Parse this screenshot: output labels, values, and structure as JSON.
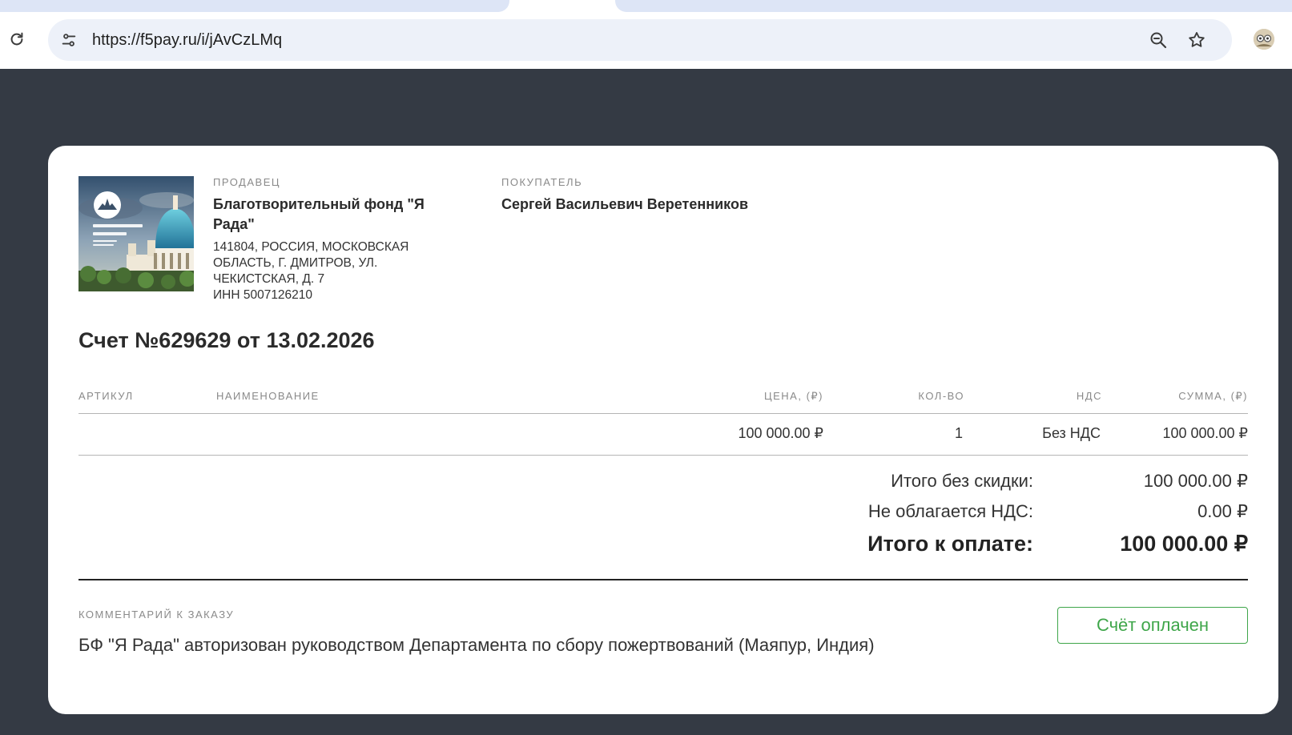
{
  "browser": {
    "url": "https://f5pay.ru/i/jAvCzLMq",
    "icons": [
      "reload-icon",
      "site-info-icon",
      "zoom-out-icon",
      "bookmark-star-icon",
      "profile-avatar"
    ]
  },
  "invoice": {
    "seller": {
      "label": "ПРОДАВЕЦ",
      "name": "Благотворительный фонд \"Я Рада\"",
      "address": "141804, РОССИЯ, МОСКОВСКАЯ ОБЛАСТЬ, Г. ДМИТРОВ, УЛ. ЧЕКИСТСКАЯ, Д. 7",
      "inn": "ИНН 5007126210"
    },
    "buyer": {
      "label": "ПОКУПАТЕЛЬ",
      "name": "Сергей Васильевич Веретенников"
    },
    "logo_text": "ХРАМ ВЕДИЧЕСКОГО ПЛАНЕТАРИЯ",
    "title": "Счет №629629 от 13.02.2026",
    "columns": {
      "article": "АРТИКУЛ",
      "name": "НАИМЕНОВАНИЕ",
      "price": "ЦЕНА, (₽)",
      "qty": "КОЛ-ВО",
      "vat": "НДС",
      "sum": "СУММА, (₽)"
    },
    "row": {
      "article": "",
      "name": "",
      "price": "100 000.00 ₽",
      "qty": "1",
      "vat": "Без НДС",
      "sum": "100 000.00 ₽"
    },
    "totals": {
      "subtotal_label": "Итого без скидки:",
      "subtotal_value": "100 000.00 ₽",
      "vat_label": "Не облагается НДС:",
      "vat_value": "0.00 ₽",
      "total_label": "Итого к оплате:",
      "total_value": "100 000.00 ₽"
    },
    "comment_label": "КОММЕНТАРИЙ К ЗАКАЗУ",
    "comment": "БФ \"Я Рада\" авторизован руководством Департамента по сбору пожертвований (Маяпур, Индия)",
    "status_button": "Счёт оплачен",
    "colors": {
      "page_bg": "#343a44",
      "paid_green": "#3fa64a"
    }
  }
}
